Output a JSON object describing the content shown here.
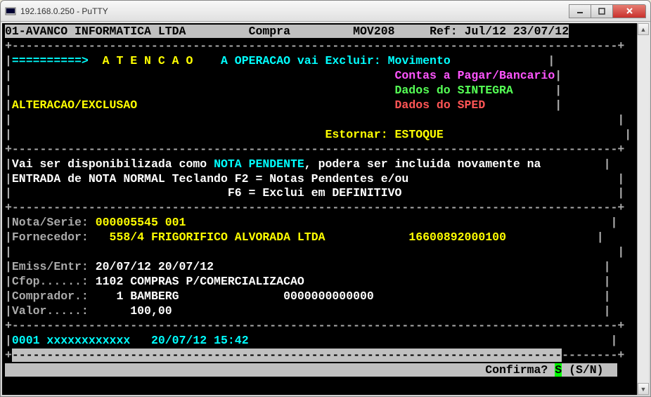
{
  "window": {
    "title": "192.168.0.250 - PuTTY"
  },
  "header": {
    "company": "01-AVANCO INFORMATICA LTDA",
    "module": "Compra",
    "code": "MOV208",
    "ref": "Ref: Jul/12 23/07/12"
  },
  "warning": {
    "arrow": "==========>",
    "atencao": "A T E N C A O",
    "op_label": "A OPERACAO vai Excluir:",
    "items": {
      "l1": "Movimento",
      "l2": "Contas a Pagar/Bancario",
      "l3": "Dados do SINTEGRA",
      "l4": "Dados do SPED"
    },
    "alt": "ALTERACAO/EXCLUSAO",
    "estornar_label": "Estornar:",
    "estornar_value": "ESTOQUE"
  },
  "info": {
    "l1a": "Vai ser disponibilizada como ",
    "l1b": "NOTA PENDENTE",
    "l1c": ", podera ser incluida novamente na",
    "l2": "ENTRADA de NOTA NORMAL Teclando F2 = Notas Pendentes e/ou",
    "l3": "                               F6 = Exclui em DEFINITIVO"
  },
  "fields": {
    "nota_label": "Nota/Serie:",
    "nota_value": "000005545 001",
    "forn_label": "Fornecedor:",
    "forn_code": "558/4",
    "forn_name": "FRIGORIFICO ALVORADA LTDA",
    "forn_cnpj": "16600892000100",
    "emiss_label": "Emiss/Entr:",
    "emiss_value": "20/07/12 20/07/12",
    "cfop_label": "Cfop......:",
    "cfop_value": "1102 COMPRAS P/COMERCIALIZACAO",
    "comp_label": "Comprador.:",
    "comp_value": "   1 BAMBERG               0000000000000",
    "valor_label": "Valor.....:",
    "valor_value": "     100,00"
  },
  "log": {
    "seq": "0001",
    "x": "xxxxxxxxxxxx",
    "ts": "20/07/12 15:42"
  },
  "confirm": {
    "label": "Confirma?",
    "value": "S",
    "hint": "(S/N)"
  }
}
